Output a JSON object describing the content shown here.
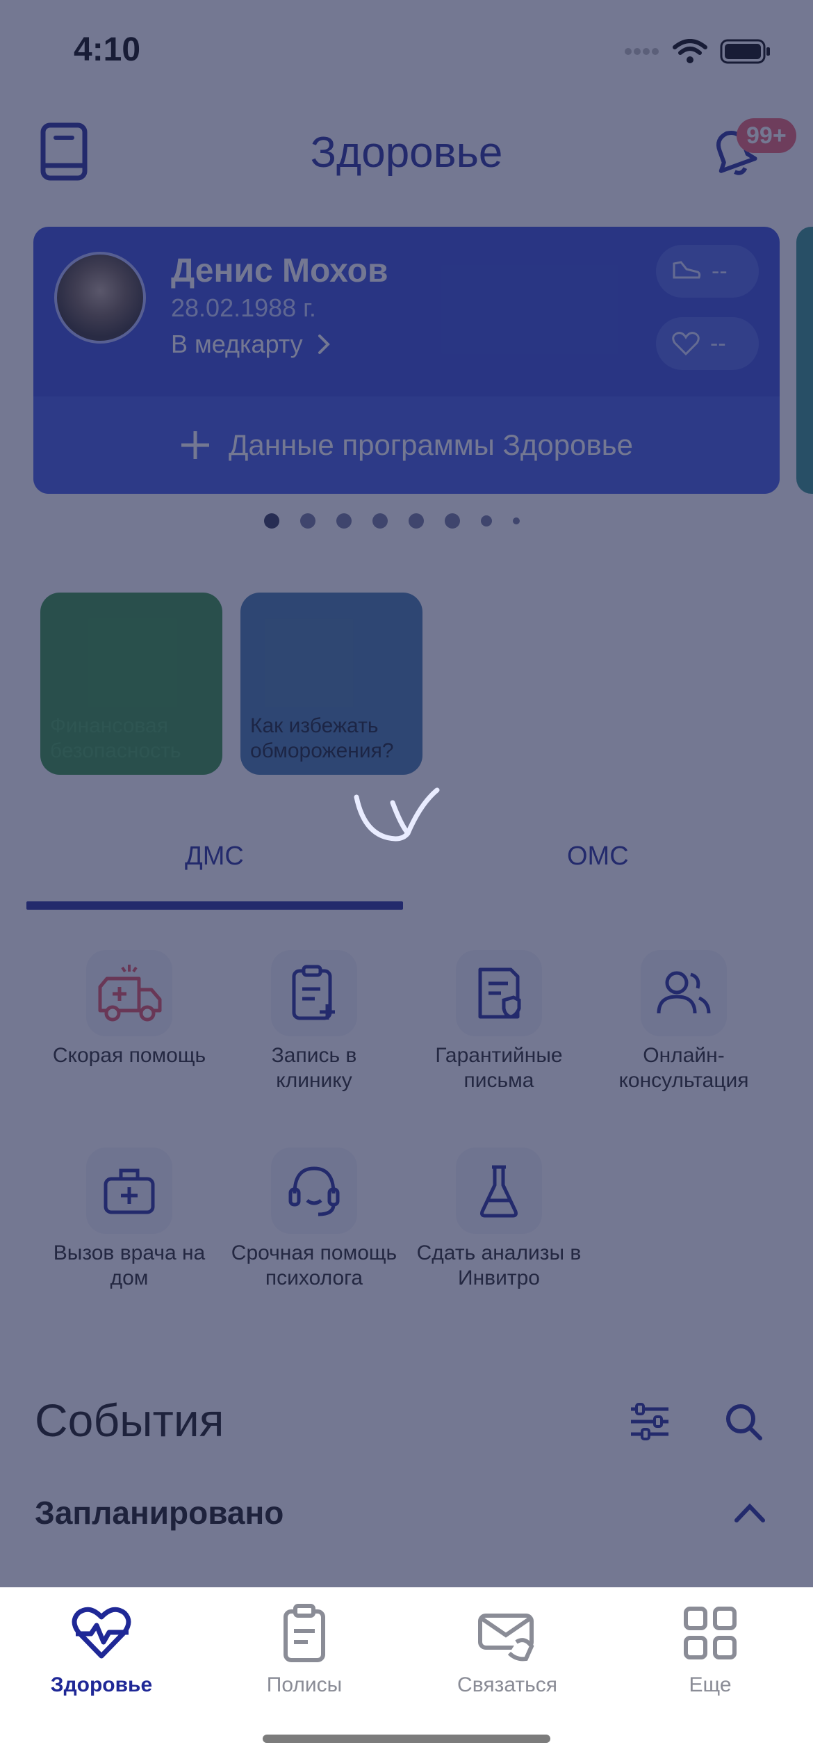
{
  "status": {
    "time": "4:10"
  },
  "header": {
    "title": "Здоровье",
    "badge": "99+"
  },
  "card": {
    "name": "Денис Мохов",
    "dob": "28.02.1988 г.",
    "link": "В медкарту",
    "steps": "--",
    "pulse": "--",
    "program": "Данные программы Здоровье"
  },
  "stories": [
    {
      "label": "Финансовая безопасность",
      "color": "#2f8f3f"
    },
    {
      "label": "Как избежать обморожения?",
      "color": "#3f76a8"
    }
  ],
  "tabs": [
    {
      "label": "ДМС",
      "active": true
    },
    {
      "label": "ОМС",
      "active": false
    }
  ],
  "services": [
    {
      "label": "Скорая помощь",
      "icon": "ambulance-icon"
    },
    {
      "label": "Запись в клинику",
      "icon": "clipboard-plus-icon"
    },
    {
      "label": "Гарантийные письма",
      "icon": "document-shield-icon"
    },
    {
      "label": "Онлайн-консультация",
      "icon": "users-icon"
    },
    {
      "label": "Вызов врача на дом",
      "icon": "medkit-icon"
    },
    {
      "label": "Срочная помощь психолога",
      "icon": "headset-icon"
    },
    {
      "label": "Сдать анализы в Инвитро",
      "icon": "flask-icon"
    }
  ],
  "events": {
    "title": "События",
    "section": "Запланировано"
  },
  "nav": [
    {
      "label": "Здоровье",
      "icon": "heart-pulse-icon",
      "active": true
    },
    {
      "label": "Полисы",
      "icon": "clipboard-icon",
      "active": false
    },
    {
      "label": "Связаться",
      "icon": "phone-mail-icon",
      "active": false
    },
    {
      "label": "Еще",
      "icon": "grid-icon",
      "active": false
    }
  ],
  "colors": {
    "brand": "#1f2896",
    "card": "#2f47d6",
    "badge": "#ef5c6a",
    "ambulance": "#e14b59"
  }
}
